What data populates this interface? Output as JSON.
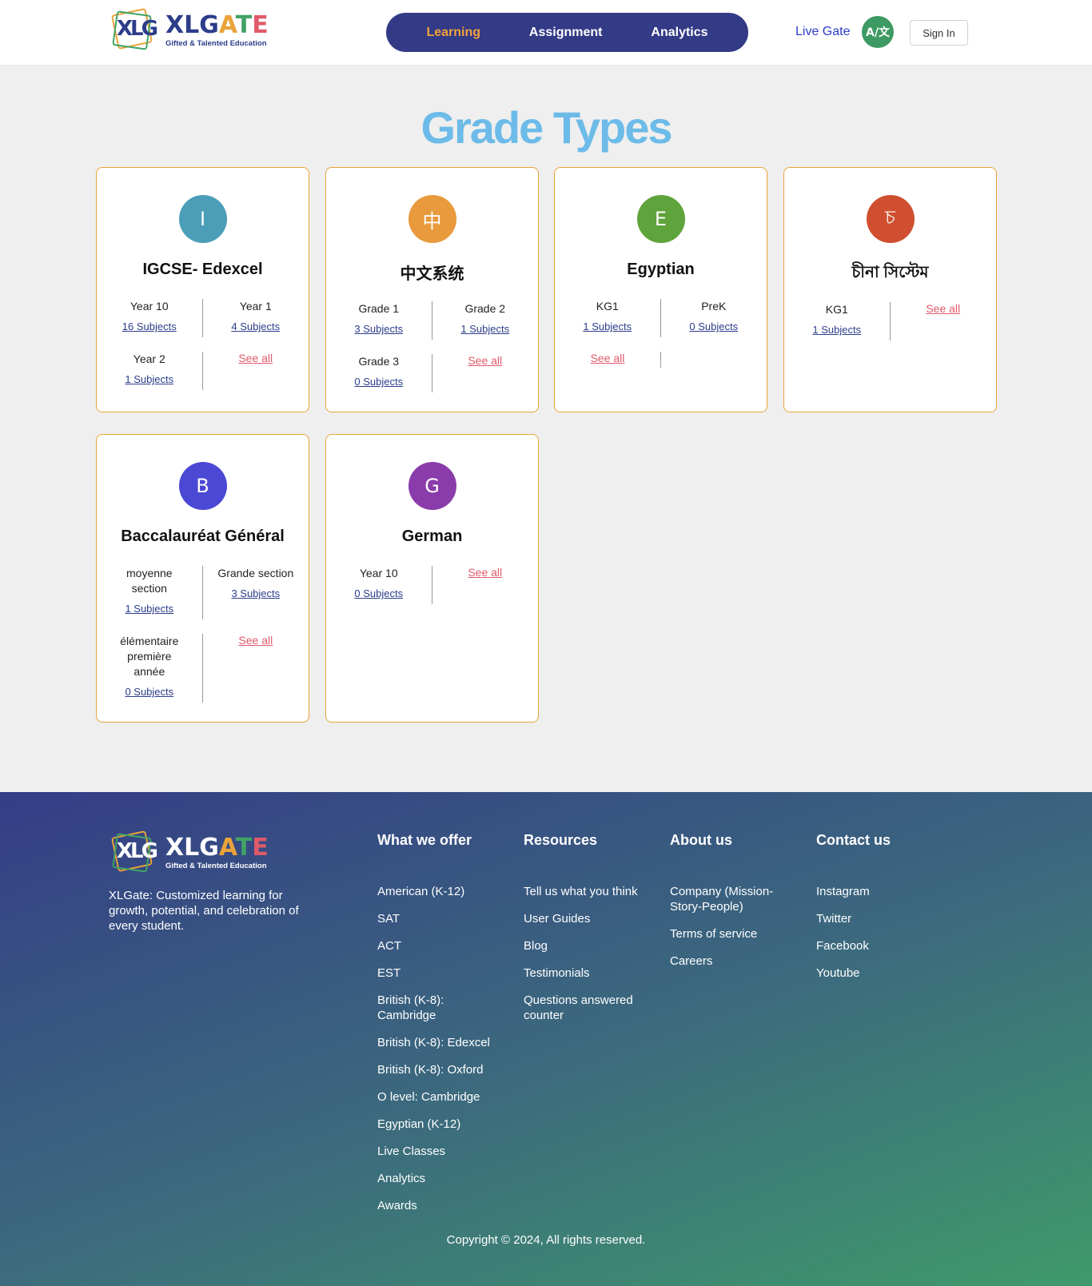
{
  "header": {
    "logo_word": [
      "X",
      "L",
      "G",
      "A",
      "T",
      "E"
    ],
    "logo_mark": "XLG",
    "logo_tagline": "Gifted & Talented Education",
    "nav": [
      "Learning",
      "Assignment",
      "Analytics"
    ],
    "live_gate": "Live Gate",
    "lang_icon": "A/文",
    "sign_in": "Sign In"
  },
  "main": {
    "title": "Grade Types",
    "cards": [
      {
        "initial": "I",
        "color": "#4b9eb8",
        "name": "IGCSE- Edexcel",
        "grades": [
          {
            "name": "Year 10",
            "subjects": "16 Subjects"
          },
          {
            "name": "Year 1",
            "subjects": "4 Subjects"
          },
          {
            "name": "Year 2",
            "subjects": "1 Subjects"
          }
        ]
      },
      {
        "initial": "中",
        "color": "#e89a3c",
        "name": "中文系统",
        "grades": [
          {
            "name": "Grade 1",
            "subjects": "3 Subjects"
          },
          {
            "name": "Grade 2",
            "subjects": "1 Subjects"
          },
          {
            "name": "Grade 3",
            "subjects": "0 Subjects"
          }
        ]
      },
      {
        "initial": "E",
        "color": "#5ea33b",
        "name": "Egyptian",
        "grades": [
          {
            "name": "KG1",
            "subjects": "1 Subjects"
          },
          {
            "name": "PreK",
            "subjects": "0 Subjects"
          }
        ]
      },
      {
        "initial": "চ",
        "color": "#cf4f30",
        "name": "চীনা সিস্টেম",
        "grades": [
          {
            "name": "KG1",
            "subjects": "1 Subjects"
          }
        ]
      },
      {
        "initial": "B",
        "color": "#4b48d6",
        "name": "Baccalauréat Général",
        "grades": [
          {
            "name": "moyenne section",
            "subjects": "1 Subjects"
          },
          {
            "name": "Grande section",
            "subjects": "3 Subjects"
          },
          {
            "name": "élémentaire première année",
            "subjects": "0 Subjects"
          }
        ]
      },
      {
        "initial": "G",
        "color": "#8a3cab",
        "name": "German",
        "grades": [
          {
            "name": "Year 10",
            "subjects": "0 Subjects"
          }
        ]
      }
    ],
    "see_all": "See all"
  },
  "footer": {
    "description": "XLGate: Customized learning for growth, potential, and celebration of every student.",
    "columns": [
      {
        "title": "What we offer",
        "links": [
          "American (K-12)",
          "SAT",
          "ACT",
          "EST",
          "British (K-8): Cambridge",
          "British (K-8): Edexcel",
          "British (K-8): Oxford",
          "O level: Cambridge",
          "Egyptian (K-12)",
          "Live Classes",
          "Analytics",
          "Awards"
        ]
      },
      {
        "title": "Resources",
        "links": [
          "Tell us what you think",
          "User Guides",
          "Blog",
          "Testimonials",
          "Questions answered counter"
        ]
      },
      {
        "title": "About us",
        "links": [
          "Company (Mission-Story-People)",
          "Terms of service",
          "Careers"
        ]
      },
      {
        "title": "Contact us",
        "links": [
          "Instagram",
          "Twitter",
          "Facebook",
          "Youtube"
        ]
      }
    ],
    "copyright": "Copyright © 2024, All rights reserved."
  }
}
